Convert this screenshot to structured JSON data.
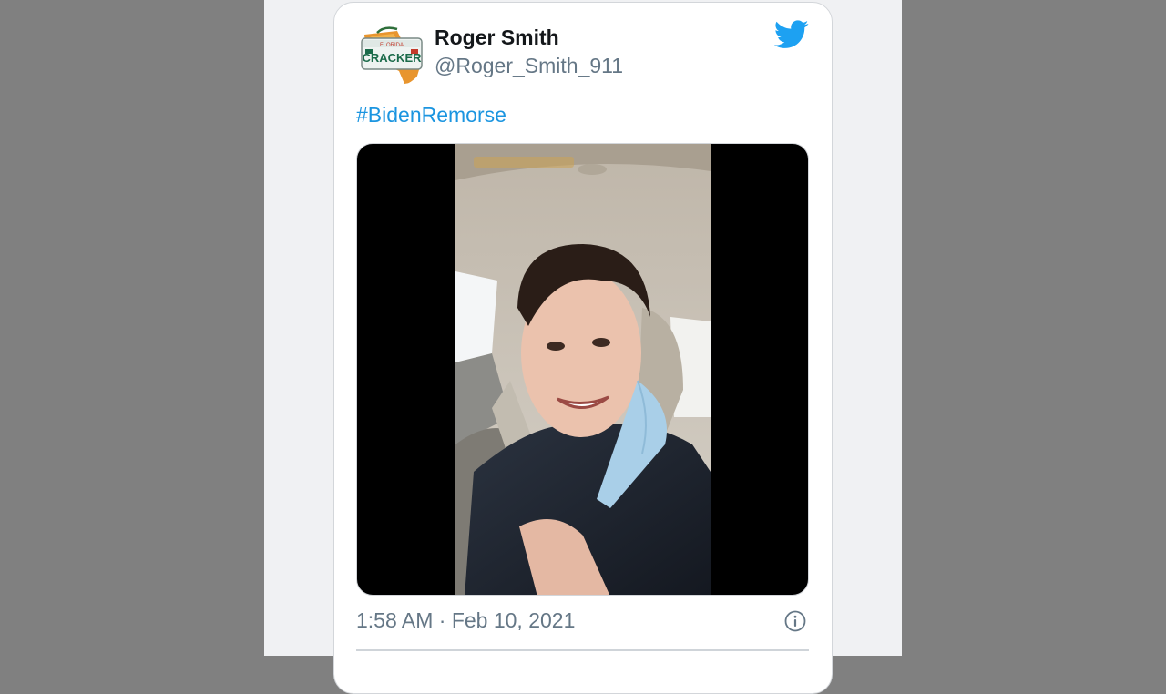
{
  "tweet": {
    "author": {
      "display_name": "Roger Smith",
      "handle": "@Roger_Smith_911",
      "avatar": {
        "plate_top": "FLORIDA",
        "plate_main": "CRACKER"
      }
    },
    "text": "#BidenRemorse",
    "media": {
      "type": "video",
      "alt_icon": "video-thumbnail"
    },
    "timestamp": "1:58 AM · Feb 10, 2021",
    "icons": {
      "brand": "twitter-bird-icon",
      "info": "info-icon"
    }
  },
  "colors": {
    "background_outer": "#808080",
    "page": "#f0f1f3",
    "card": "#ffffff",
    "card_border": "#d3d6da",
    "name": "#14171a",
    "secondary_text": "#657786",
    "link": "#1b95e0",
    "twitter_blue": "#1da1f2"
  }
}
